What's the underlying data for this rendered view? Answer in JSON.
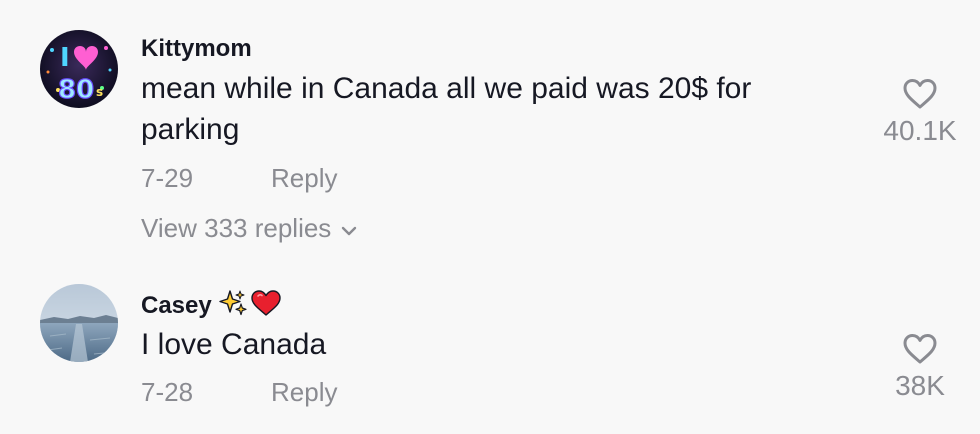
{
  "comments": [
    {
      "username": "Kittymom",
      "avatar_icon": "i-love-80s-avatar",
      "avatar_text": "I 80s",
      "text": "mean while in Canada all we paid was 20$ for parking",
      "date": "7-29",
      "reply_label": "Reply",
      "likes": "40.1K",
      "view_replies_label": "View 333 replies"
    },
    {
      "username": "Casey",
      "username_emojis": [
        "sparkles-icon",
        "red-heart-icon"
      ],
      "avatar_icon": "frozen-lake-avatar",
      "text": "I love Canada",
      "date": "7-28",
      "reply_label": "Reply",
      "likes": "38K"
    }
  ],
  "colors": {
    "background": "#f8f8f8",
    "primary_text": "#161823",
    "secondary_text": "#8a8b91"
  }
}
